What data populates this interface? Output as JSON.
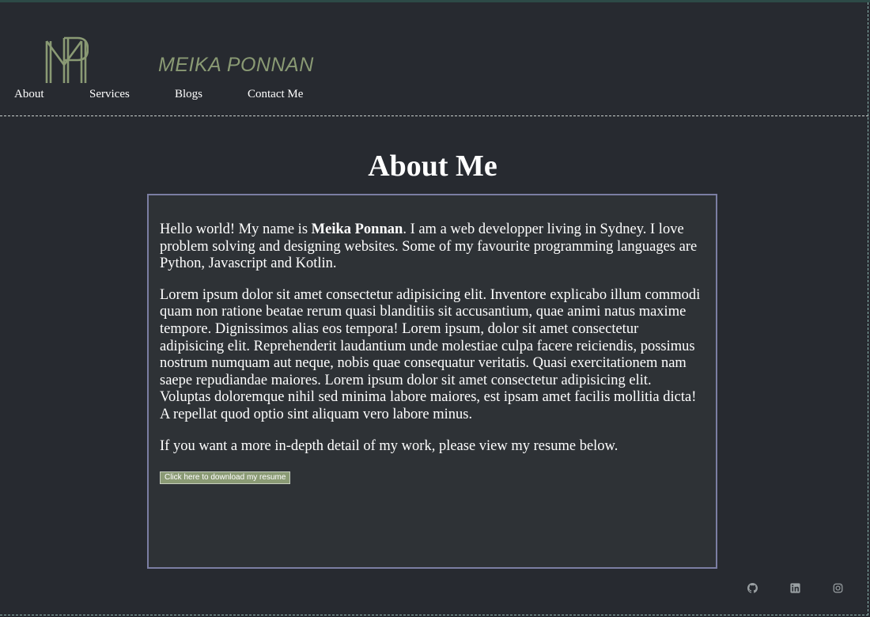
{
  "brand": {
    "name": "MEIKA PONNAN",
    "logo_icon": "mp-monogram-icon",
    "logo_color": "#8a9a74"
  },
  "nav": {
    "items": [
      {
        "label": "About"
      },
      {
        "label": "Services"
      },
      {
        "label": "Blogs"
      },
      {
        "label": "Contact Me"
      }
    ]
  },
  "about": {
    "title": "About Me",
    "intro_before": "Hello world! My name is ",
    "intro_name": "Meika Ponnan",
    "intro_after": ". I am a web developper living in Sydney. I love problem solving and designing websites. Some of my favourite programming languages are Python, Javascript and Kotlin.",
    "lorem": "Lorem ipsum dolor sit amet consectetur adipisicing elit. Inventore explicabo illum commodi quam non ratione beatae rerum quasi blanditiis sit accusantium, quae animi natus maxime tempore. Dignissimos alias eos tempora! Lorem ipsum, dolor sit amet consectetur adipisicing elit. Reprehenderit laudantium unde molestiae culpa facere reiciendis, possimus nostrum numquam aut neque, nobis quae consequatur veritatis. Quasi exercitationem nam saepe repudiandae maiores. Lorem ipsum dolor sit amet consectetur adipisicing elit. Voluptas doloremque nihil sed minima labore maiores, est ipsam amet facilis mollitia dicta! A repellat quod optio sint aliquam vero labore minus.",
    "resume_note": "If you want a more in-depth detail of my work, please view my resume below.",
    "resume_button": "Click here to download my resume"
  },
  "footer": {
    "social": [
      {
        "icon": "github-icon"
      },
      {
        "icon": "linkedin-icon"
      },
      {
        "icon": "instagram-icon"
      }
    ]
  },
  "colors": {
    "background": "#272a30",
    "card": "#2e3236",
    "card_border": "#7b7ea3",
    "accent": "#8a9a74"
  }
}
